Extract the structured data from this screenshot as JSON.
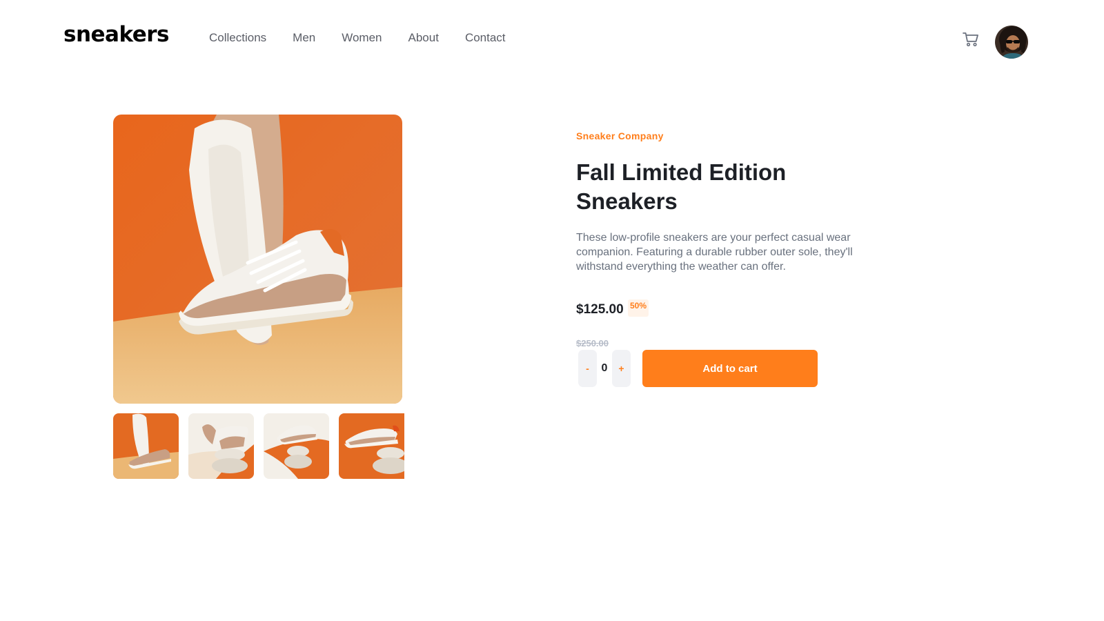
{
  "header": {
    "logo": "sneakers",
    "nav": [
      "Collections",
      "Men",
      "Women",
      "About",
      "Contact"
    ],
    "icons": {
      "cart": "cart-icon",
      "avatar": "user-avatar"
    }
  },
  "gallery": {
    "main_image": "sneaker-product-photo",
    "thumbnails": [
      "sneaker-thumbnail-1",
      "sneaker-thumbnail-2",
      "sneaker-thumbnail-3",
      "sneaker-thumbnail-4"
    ]
  },
  "product": {
    "company": "Sneaker Company",
    "title": "Fall Limited Edition Sneakers",
    "description": "These low-profile sneakers are your perfect casual wear companion. Featuring a durable rubber outer sole, they'll withstand everything the weather can offer.",
    "price": "$125.00",
    "discount": "50%",
    "old_price": "$250.00"
  },
  "cart_controls": {
    "minus": "-",
    "quantity": "0",
    "plus": "+",
    "add_label": "Add to cart"
  },
  "colors": {
    "accent": "#ff7e1b",
    "accent_light": "#fff3e9",
    "text_dark": "#1d2026",
    "text_muted": "#68707d",
    "text_faded": "#b6bcc8"
  }
}
